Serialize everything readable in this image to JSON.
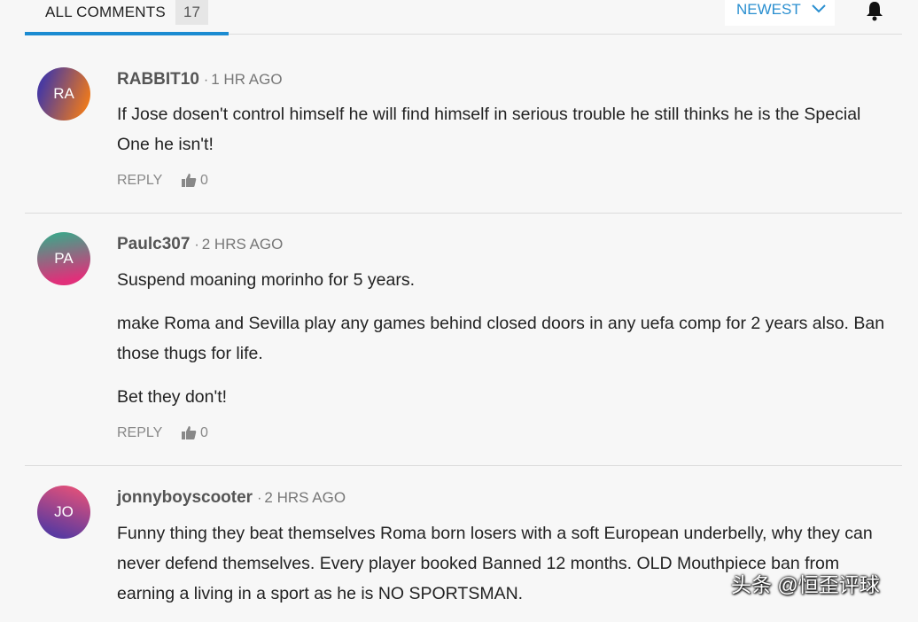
{
  "header": {
    "tab_label": "ALL COMMENTS",
    "count": "17",
    "sort_label": "NEWEST"
  },
  "comments": [
    {
      "avatar": "RA",
      "username": "RABBIT10",
      "time": "1 HR AGO",
      "paragraphs": [
        "If Jose dosen't control himself he will find himself in serious trouble he still thinks he is the Special One he isn't!"
      ],
      "reply_label": "REPLY",
      "likes": "0"
    },
    {
      "avatar": "PA",
      "username": "Paulc307",
      "time": "2 HRS AGO",
      "paragraphs": [
        "Suspend moaning morinho for 5 years.",
        "make Roma and Sevilla play any games behind closed doors in any uefa comp for 2 years also. Ban those thugs for life.",
        "Bet they don't!"
      ],
      "reply_label": "REPLY",
      "likes": "0"
    },
    {
      "avatar": "JO",
      "username": "jonnyboyscooter",
      "time": "2 HRS AGO",
      "paragraphs": [
        "Funny thing they beat themselves Roma born losers with a soft European underbelly, why they can never defend themselves. Every player booked Banned 12 months. OLD Mouthpiece ban from earning a living in a sport as he is NO SPORTSMAN."
      ]
    }
  ],
  "dot": "·",
  "watermark": "头条 @恒歪评球",
  "colors": {
    "accent": "#1b8bd1",
    "avatar_ra": [
      "#4a3aa0",
      "#f07a1a"
    ],
    "avatar_pa": [
      "#3aa88a",
      "#e0307a"
    ],
    "avatar_jo": [
      "#e0507a",
      "#5a3aa0"
    ]
  }
}
